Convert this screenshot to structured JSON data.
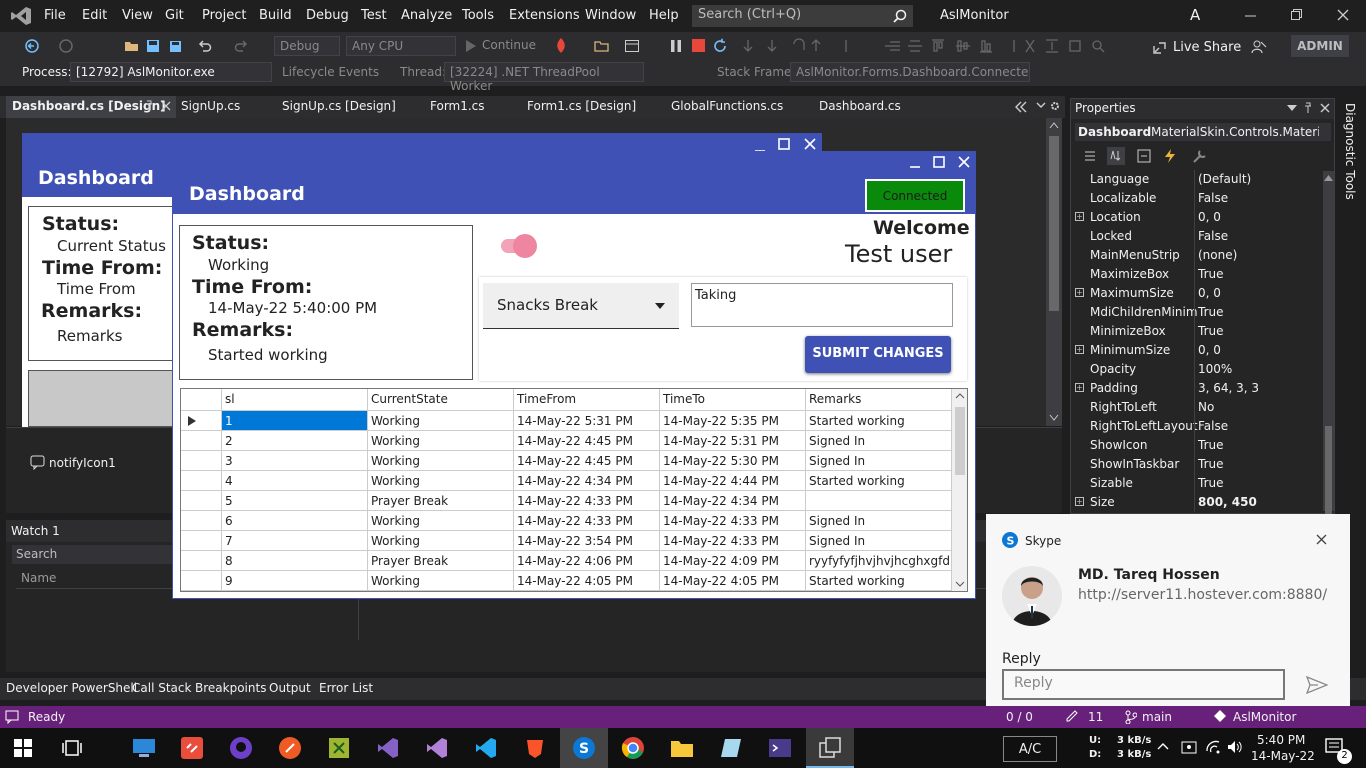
{
  "menubar": {
    "items": [
      "File",
      "Edit",
      "View",
      "Git",
      "Project",
      "Build",
      "Debug",
      "Test",
      "Analyze",
      "Tools",
      "Extensions",
      "Window",
      "Help"
    ],
    "search_placeholder": "Search (Ctrl+Q)",
    "solution_name": "AslMonitor",
    "avatar_letter": "A"
  },
  "toolbar": {
    "config": "Debug",
    "platform": "Any CPU",
    "continue_label": "Continue",
    "live_share": "Live Share",
    "admin": "ADMIN"
  },
  "debugbar": {
    "process_label": "Process:",
    "process_value": "[12792] AslMonitor.exe",
    "lifecycle": "Lifecycle Events",
    "thread_label": "Thread:",
    "thread_value": "[32224] .NET ThreadPool Worker",
    "stackframe_label": "Stack Frame:",
    "stackframe_value": "AslMonitor.Forms.Dashboard.Connected."
  },
  "tabs": {
    "active": "Dashboard.cs [Design]",
    "others": [
      "SignUp.cs",
      "SignUp.cs [Design]",
      "Form1.cs",
      "Form1.cs [Design]",
      "GlobalFunctions.cs",
      "Dashboard.cs"
    ]
  },
  "backform": {
    "header_title": "Dashboard",
    "status_label": "Status:",
    "status_value": "Current Status",
    "time_from_label": "Time From:",
    "time_from_value": "Time From",
    "remarks_label": "Remarks:",
    "remarks_value": "Remarks"
  },
  "tray": {
    "component": "notifyIcon1"
  },
  "watch": {
    "title": "Watch 1",
    "search": "Search",
    "name_col": "Name"
  },
  "frontform": {
    "header_title": "Dashboard",
    "connected_label": "Connected",
    "welcome": "Welcome",
    "user": "Test user",
    "status_label": "Status:",
    "status_value": "Working",
    "time_from_label": "Time From:",
    "time_from_value": "14-May-22 5:40:00 PM",
    "remarks_label": "Remarks:",
    "remarks_value": "Started working",
    "state_select": "Snacks Break",
    "remarks_input": "Taking",
    "submit": "SUBMIT CHANGES",
    "toggle_on": true,
    "columns": [
      "sl",
      "CurrentState",
      "TimeFrom",
      "TimeTo",
      "Remarks"
    ],
    "rows": [
      [
        "1",
        "Working",
        "14-May-22 5:31 PM",
        "14-May-22 5:35 PM",
        "Started working"
      ],
      [
        "2",
        "Working",
        "14-May-22 4:45 PM",
        "14-May-22 5:31 PM",
        "Signed In"
      ],
      [
        "3",
        "Working",
        "14-May-22 4:45 PM",
        "14-May-22 5:30 PM",
        "Signed In"
      ],
      [
        "4",
        "Working",
        "14-May-22 4:34 PM",
        "14-May-22 4:44 PM",
        "Started working"
      ],
      [
        "5",
        "Prayer Break",
        "14-May-22 4:33 PM",
        "14-May-22 4:34 PM",
        ""
      ],
      [
        "6",
        "Working",
        "14-May-22 4:33 PM",
        "14-May-22 4:33 PM",
        "Signed In"
      ],
      [
        "7",
        "Working",
        "14-May-22 3:54 PM",
        "14-May-22 4:33 PM",
        "Signed In"
      ],
      [
        "8",
        "Prayer Break",
        "14-May-22 4:06 PM",
        "14-May-22 4:09 PM",
        "ryyfyfyfjhvjhvjhcghxgfd ..."
      ],
      [
        "9",
        "Working",
        "14-May-22 4:05 PM",
        "14-May-22 4:05 PM",
        "Started working"
      ]
    ]
  },
  "properties": {
    "title": "Properties",
    "object": "Dashboard",
    "object_type": "MaterialSkin.Controls.MaterialFor",
    "rows": [
      {
        "name": "Language",
        "value": "(Default)",
        "expand": false
      },
      {
        "name": "Localizable",
        "value": "False",
        "expand": false
      },
      {
        "name": "Location",
        "value": "0, 0",
        "expand": true
      },
      {
        "name": "Locked",
        "value": "False",
        "expand": false
      },
      {
        "name": "MainMenuStrip",
        "value": "(none)",
        "expand": false
      },
      {
        "name": "MaximizeBox",
        "value": "True",
        "expand": false
      },
      {
        "name": "MaximumSize",
        "value": "0, 0",
        "expand": true
      },
      {
        "name": "MdiChildrenMinim",
        "value": "True",
        "expand": false
      },
      {
        "name": "MinimizeBox",
        "value": "True",
        "expand": false
      },
      {
        "name": "MinimumSize",
        "value": "0, 0",
        "expand": true
      },
      {
        "name": "Opacity",
        "value": "100%",
        "expand": false
      },
      {
        "name": "Padding",
        "value": "3, 64, 3, 3",
        "expand": true
      },
      {
        "name": "RightToLeft",
        "value": "No",
        "expand": false
      },
      {
        "name": "RightToLeftLayout",
        "value": "False",
        "expand": false
      },
      {
        "name": "ShowIcon",
        "value": "True",
        "expand": false
      },
      {
        "name": "ShowInTaskbar",
        "value": "True",
        "expand": false
      },
      {
        "name": "Sizable",
        "value": "True",
        "expand": false
      },
      {
        "name": "Size",
        "value": "800, 450",
        "expand": true
      }
    ]
  },
  "diagnostic_tab": "Diagnostic Tools",
  "bottomtabs": [
    "Developer PowerShell",
    "Call Stack",
    "Breakpoints",
    "Output",
    "Error List"
  ],
  "status": {
    "ready": "Ready",
    "counter": "0 / 0",
    "errors": "11",
    "branch": "main",
    "repo": "AslMonitor"
  },
  "skype": {
    "app": "Skype",
    "sender": "MD. Tareq Hossen",
    "message": "http://server11.hostever.com:8880/",
    "reply_heading": "Reply",
    "reply_placeholder": "Reply"
  },
  "taskbar": {
    "ac": "A/C",
    "net_up_label": "U:",
    "net_up": "3 kB/s",
    "net_down_label": "D:",
    "net_down": "3 kB/s",
    "time": "5:40 PM",
    "date": "14-May-22",
    "notifications": "2"
  }
}
